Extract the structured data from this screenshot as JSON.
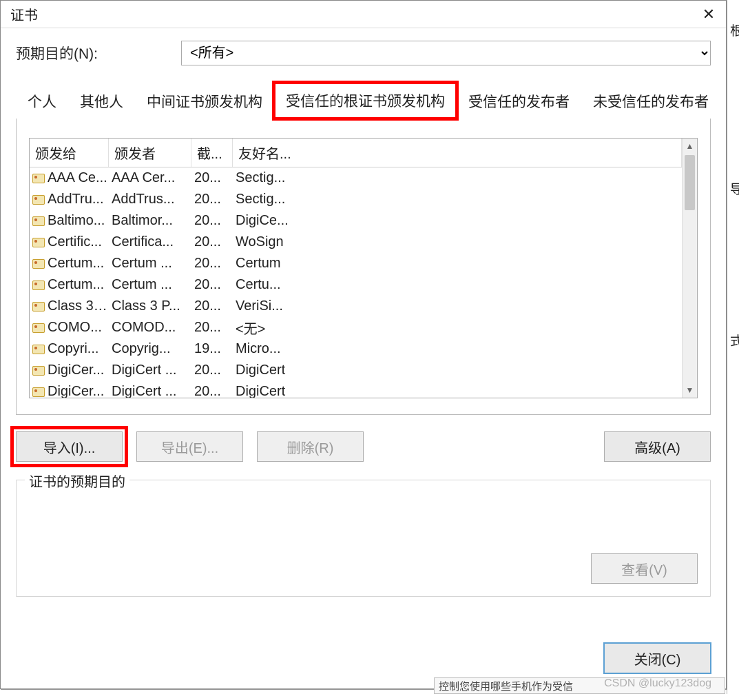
{
  "backdrop": {
    "char1": "根",
    "char2": "导",
    "char3": "式"
  },
  "dialog": {
    "title": "证书",
    "close_glyph": "✕",
    "purpose_label": "预期目的(N):",
    "purpose_selected": "<所有>"
  },
  "tabs": [
    {
      "label": "个人"
    },
    {
      "label": "其他人"
    },
    {
      "label": "中间证书颁发机构"
    },
    {
      "label": "受信任的根证书颁发机构",
      "active": true,
      "highlight": true
    },
    {
      "label": "受信任的发布者"
    },
    {
      "label": "未受信任的发布者"
    }
  ],
  "columns": {
    "issued_to": "颁发给",
    "issued_by": "颁发者",
    "expire": "截...",
    "friendly": "友好名..."
  },
  "rows": [
    {
      "to": "AAA Ce...",
      "by": "AAA Cer...",
      "exp": "20...",
      "fr": "Sectig..."
    },
    {
      "to": "AddTru...",
      "by": "AddTrus...",
      "exp": "20...",
      "fr": "Sectig..."
    },
    {
      "to": "Baltimo...",
      "by": "Baltimor...",
      "exp": "20...",
      "fr": "DigiCe..."
    },
    {
      "to": "Certific...",
      "by": "Certifica...",
      "exp": "20...",
      "fr": "WoSign"
    },
    {
      "to": "Certum...",
      "by": "Certum ...",
      "exp": "20...",
      "fr": "Certum"
    },
    {
      "to": "Certum...",
      "by": "Certum ...",
      "exp": "20...",
      "fr": "Certu..."
    },
    {
      "to": "Class 3 ...",
      "by": "Class 3 P...",
      "exp": "20...",
      "fr": "VeriSi..."
    },
    {
      "to": "COMO...",
      "by": "COMOD...",
      "exp": "20...",
      "fr": "<无>"
    },
    {
      "to": "Copyri...",
      "by": "Copyrig...",
      "exp": "19...",
      "fr": "Micro..."
    },
    {
      "to": "DigiCer...",
      "by": "DigiCert ...",
      "exp": "20...",
      "fr": "DigiCert"
    },
    {
      "to": "DigiCer...",
      "by": "DigiCert ...",
      "exp": "20...",
      "fr": "DigiCert"
    }
  ],
  "buttons": {
    "import": "导入(I)...",
    "export": "导出(E)...",
    "remove": "删除(R)",
    "advanced": "高级(A)",
    "view": "查看(V)",
    "close": "关闭(C)"
  },
  "intended_purposes_legend": "证书的预期目的",
  "watermark": "CSDN @lucky123dog",
  "under_strip": "控制您使用哪些手机作为受信"
}
